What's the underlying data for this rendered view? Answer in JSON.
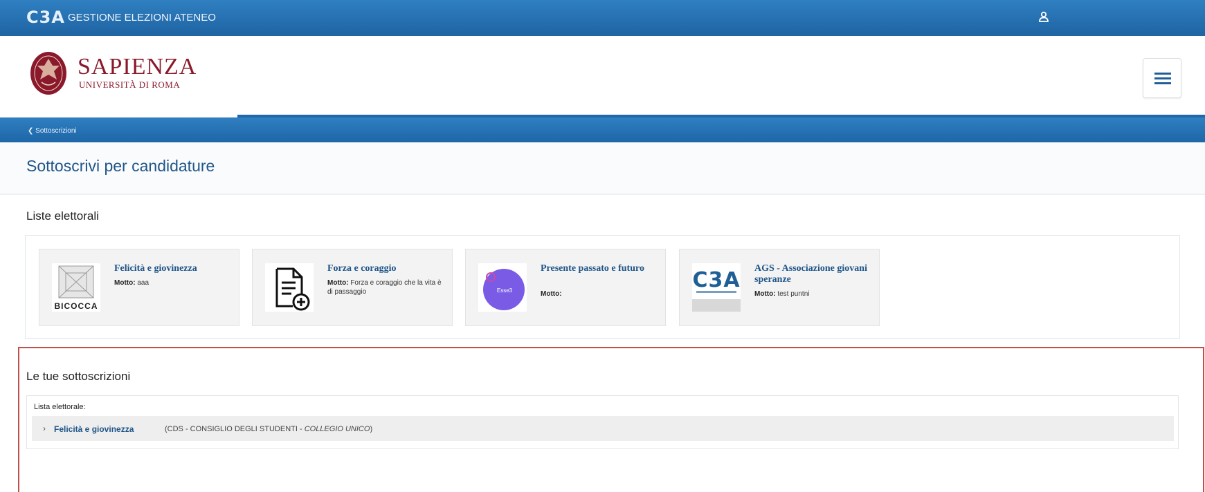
{
  "topbar": {
    "logo_text": "C3A",
    "title": "GESTIONE ELEZIONI ATENEO",
    "user_icon": "user-icon"
  },
  "header": {
    "university_name": "SAPIENZA",
    "university_sub": "UNIVERSITÀ DI ROMA",
    "menu_icon": "hamburger-icon"
  },
  "breadcrumb": {
    "back_label": "Sottoscrizioni"
  },
  "page": {
    "title": "Sottoscrivi per candidature"
  },
  "liste": {
    "section_title": "Liste elettorali",
    "motto_label": "Motto:",
    "cards": [
      {
        "name": "Felicità e giovinezza",
        "motto": "aaa",
        "image": "bicocca-logo",
        "image_text": "BICOCCA"
      },
      {
        "name": "Forza e coraggio",
        "motto": "Forza e coraggio che la vita è di passaggio",
        "image": "document-add-icon"
      },
      {
        "name": "Presente passato e futuro",
        "motto": "",
        "image": "purple-circle-logo",
        "image_text": "Esse3"
      },
      {
        "name": "AGS - Associazione giovani speranze",
        "motto": "test puntni",
        "image": "c3a-logo",
        "image_text": "C3A"
      }
    ]
  },
  "subscriptions": {
    "title": "Le tue sottoscrizioni",
    "list_label": "Lista elettorale:",
    "items": [
      {
        "name": "Felicità e giovinezza",
        "desc_prefix": "(CDS - CONSIGLIO DEGLI STUDENTI - ",
        "desc_italic": "COLLEGIO UNICO",
        "desc_suffix": ")"
      }
    ]
  },
  "colors": {
    "primary_blue": "#1f64a3",
    "title_blue": "#1f5588",
    "sapienza_red": "#8a1a2b",
    "highlight_red": "#c0504d",
    "card_bg": "#f3f3f3"
  }
}
